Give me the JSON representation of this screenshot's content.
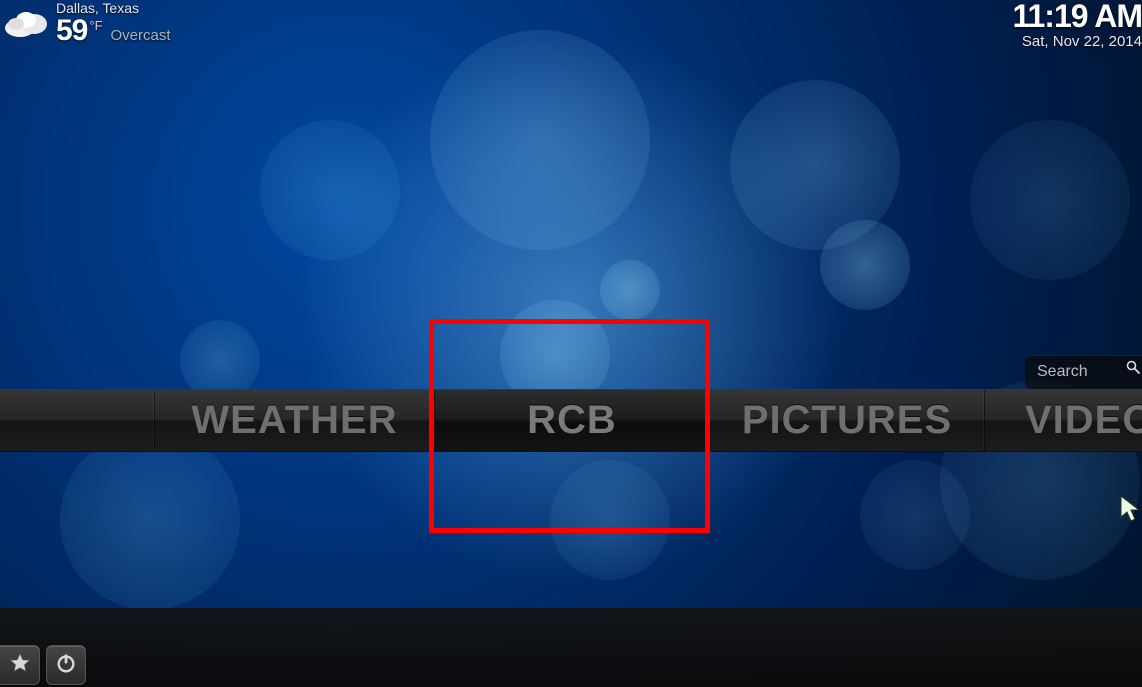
{
  "weather": {
    "location": "Dallas, Texas",
    "temperature": "59",
    "unit": "°F",
    "condition": "Overcast",
    "icon": "cloud-overcast-icon"
  },
  "clock": {
    "time": "11:19 AM",
    "date": "Sat, Nov 22, 2014"
  },
  "search": {
    "placeholder": "Search"
  },
  "menu": {
    "items": [
      {
        "label": "WEATHER",
        "selected": false
      },
      {
        "label": "RCB",
        "selected": true
      },
      {
        "label": "PICTURES",
        "selected": false
      },
      {
        "label": "VIDEOS",
        "selected": false
      }
    ]
  },
  "highlight": {
    "target": "RCB",
    "color": "#ff0000"
  },
  "bottom_buttons": {
    "favorites": "favorites-icon",
    "power": "power-icon"
  }
}
